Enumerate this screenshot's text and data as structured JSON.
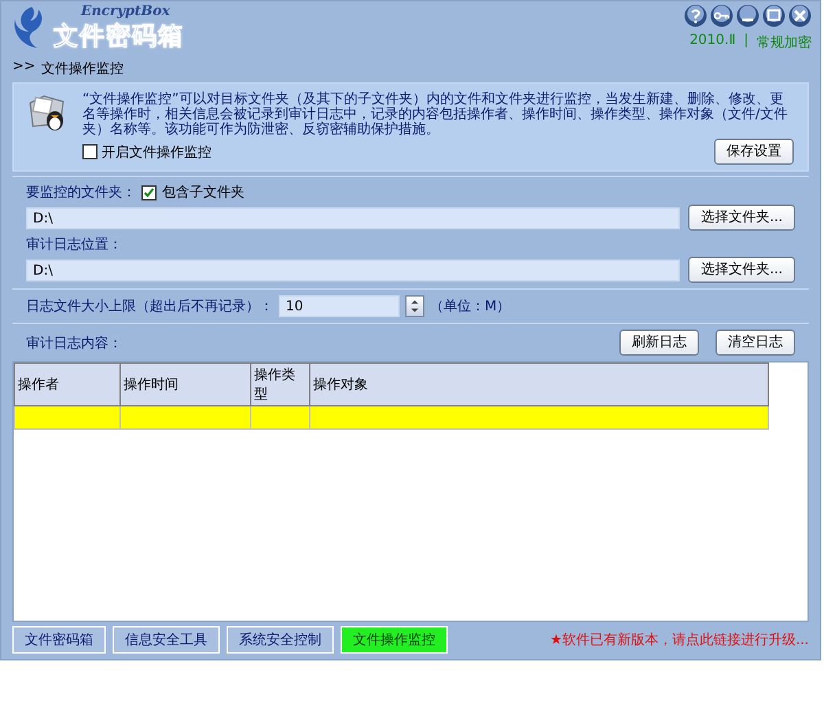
{
  "app": {
    "logo_subtitle": "EncryptBox",
    "logo_title": "文件密码箱",
    "version": "2010.Ⅱ",
    "separator": "|",
    "edition": "常规加密"
  },
  "breadcrumb": {
    "marker": ">>",
    "label": "文件操作监控"
  },
  "intro": {
    "description": "“文件操作监控”可以对目标文件夹（及其下的子文件夹）内的文件和文件夹进行监控，当发生新建、删除、修改、更名等操作时，相关信息会被记录到审计日志中，记录的内容包括操作者、操作时间、操作类型、操作对象（文件/文件夹）名称等。该功能可作为防泄密、反窃密辅助保护措施。",
    "enable_label": "开启文件操作监控",
    "enable_checked": false,
    "save_button": "保存设置"
  },
  "folders": {
    "monitor_label": "要监控的文件夹：",
    "include_sub_label": "包含子文件夹",
    "include_sub_checked": true,
    "monitor_path": "D:\\",
    "browse_button_1": "选择文件夹...",
    "log_label": "审计日志位置：",
    "log_path": "D:\\",
    "browse_button_2": "选择文件夹..."
  },
  "size_limit": {
    "label": "日志文件大小上限（超出后不再记录）：",
    "value": "10",
    "unit": "（单位：M）"
  },
  "log": {
    "label": "审计日志内容：",
    "refresh_button": "刷新日志",
    "clear_button": "清空日志",
    "columns": [
      "操作者",
      "操作时间",
      "操作类型",
      "操作对象"
    ],
    "rows": [
      {
        "selected": true
      }
    ]
  },
  "nav_tabs": [
    {
      "label": "文件密码箱",
      "selected": false
    },
    {
      "label": "信息安全工具",
      "selected": false
    },
    {
      "label": "系统安全控制",
      "selected": false
    },
    {
      "label": "文件操作监控",
      "selected": true
    }
  ],
  "upgrade_link": "★软件已有新版本，请点此链接进行升级..."
}
